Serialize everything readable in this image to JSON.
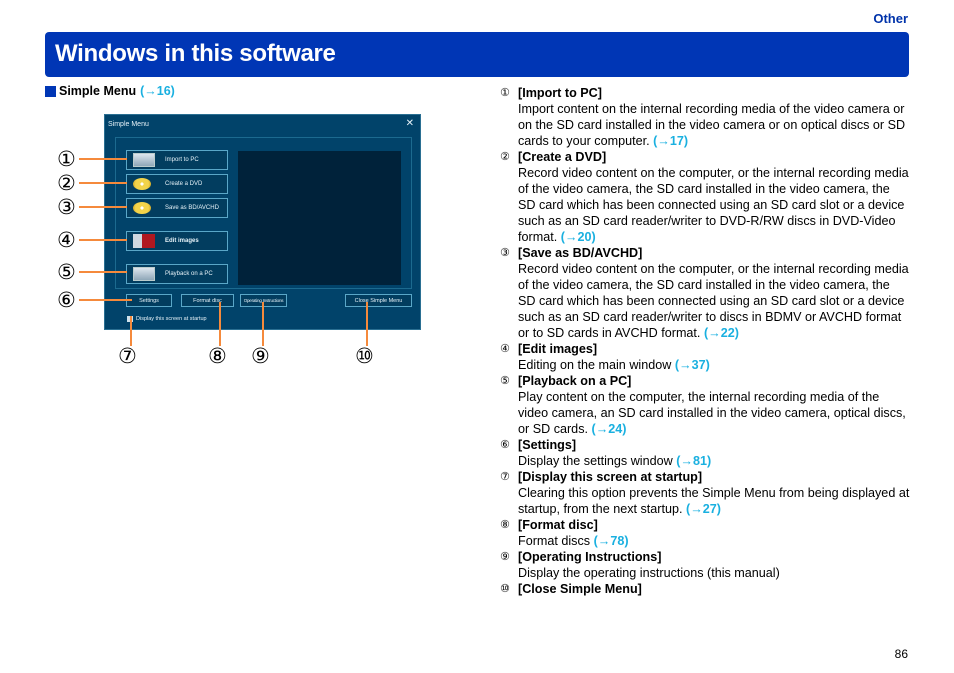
{
  "header": {
    "section": "Other",
    "title": "Windows in this software"
  },
  "subheading": {
    "label": "Simple Menu",
    "ref": "(→16)"
  },
  "window": {
    "title": "Simple Menu",
    "close_glyph": "✕",
    "buttons": {
      "import": "Import to PC",
      "dvd": "Create a DVD",
      "bd": "Save as BD/AVCHD",
      "edit": "Edit images",
      "playback": "Playback on a PC",
      "settings": "Settings",
      "format": "Format disc",
      "instructions": "Operating Instructions",
      "close": "Close Simple Menu"
    },
    "startup_checkbox": {
      "label": "Display this screen at startup",
      "checked": true
    }
  },
  "callouts": [
    "①",
    "②",
    "③",
    "④",
    "⑤",
    "⑥",
    "⑦",
    "⑧",
    "⑨",
    "⑩"
  ],
  "items": [
    {
      "num": "①",
      "title": "[Import to PC]",
      "body": "Import content on the internal recording media of the video camera or on the SD card installed in the video camera or on optical discs or SD cards to your computer.",
      "ref": "(→17)"
    },
    {
      "num": "②",
      "title": "[Create a DVD]",
      "body": "Record video content on the computer, or the internal recording media of the video camera, the SD card installed in the video camera, the SD card which has been connected using an SD card slot or a device such as an SD card reader/writer to DVD-R/RW discs in DVD-Video format.",
      "ref": "(→20)"
    },
    {
      "num": "③",
      "title": "[Save as BD/AVCHD]",
      "body": "Record video content on the computer, or the internal recording media of the video camera, the SD card installed in the video camera, the SD card which has been connected using an SD card slot or a device such as an SD card reader/writer to discs in BDMV or AVCHD format or to SD cards in AVCHD format.",
      "ref": "(→22)"
    },
    {
      "num": "④",
      "title": "[Edit images]",
      "body": "Editing on the main window",
      "ref": "(→37)"
    },
    {
      "num": "⑤",
      "title": "[Playback on a PC]",
      "body": "Play content on the computer, the internal recording media of the video camera, an SD card installed in the video camera, optical discs, or SD cards.",
      "ref": "(→24)"
    },
    {
      "num": "⑥",
      "title": "[Settings]",
      "body": "Display the settings window",
      "ref": "(→81)"
    },
    {
      "num": "⑦",
      "title": "[Display this screen at startup]",
      "body": "Clearing this option prevents the Simple Menu from being displayed at startup, from the next startup.",
      "ref": "(→27)"
    },
    {
      "num": "⑧",
      "title": "[Format disc]",
      "body": "Format discs",
      "ref": "(→78)"
    },
    {
      "num": "⑨",
      "title": "[Operating Instructions]",
      "body": "Display the operating instructions (this manual)",
      "ref": ""
    },
    {
      "num": "⑩",
      "title": "[Close Simple Menu]",
      "body": "",
      "ref": ""
    }
  ],
  "footer": {
    "page": "86"
  }
}
